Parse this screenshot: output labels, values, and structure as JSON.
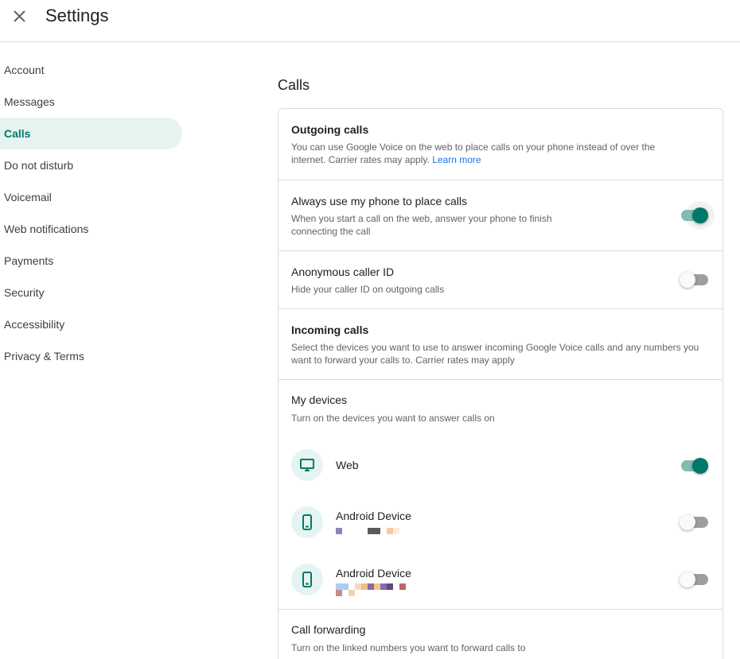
{
  "header": {
    "title": "Settings",
    "close_icon": "close-icon"
  },
  "sidebar": {
    "items": [
      {
        "label": "Account",
        "active": false
      },
      {
        "label": "Messages",
        "active": false
      },
      {
        "label": "Calls",
        "active": true
      },
      {
        "label": "Do not disturb",
        "active": false
      },
      {
        "label": "Voicemail",
        "active": false
      },
      {
        "label": "Web notifications",
        "active": false
      },
      {
        "label": "Payments",
        "active": false
      },
      {
        "label": "Security",
        "active": false
      },
      {
        "label": "Accessibility",
        "active": false
      },
      {
        "label": "Privacy & Terms",
        "active": false
      }
    ]
  },
  "main": {
    "section_title": "Calls",
    "outgoing": {
      "heading": "Outgoing calls",
      "description": "You can use Google Voice on the web to place calls on your phone instead of over the internet. Carrier rates may apply.",
      "learn_more": "Learn more"
    },
    "always_use_phone": {
      "title": "Always use my phone to place calls",
      "description": "When you start a call on the web, answer your phone to finish connecting the call",
      "enabled": true
    },
    "anonymous_caller_id": {
      "title": "Anonymous caller ID",
      "description": "Hide your caller ID on outgoing calls",
      "enabled": false
    },
    "incoming": {
      "heading": "Incoming calls",
      "description": "Select the devices you want to use to answer incoming Google Voice calls and any numbers you want to forward your calls to. Carrier rates may apply"
    },
    "my_devices": {
      "title": "My devices",
      "description": "Turn on the devices you want to answer calls on",
      "devices": [
        {
          "name": "Web",
          "icon": "monitor-icon",
          "enabled": true
        },
        {
          "name": "Android Device",
          "icon": "phone-icon",
          "enabled": false
        },
        {
          "name": "Android Device",
          "icon": "phone-icon",
          "enabled": false
        }
      ]
    },
    "call_forwarding": {
      "title": "Call forwarding",
      "description": "Turn on the linked numbers you want to forward calls to"
    }
  },
  "colors": {
    "accent": "#00796b",
    "accent_light": "#e6f4f1",
    "link": "#1a73e8",
    "divider": "#dadce0"
  }
}
